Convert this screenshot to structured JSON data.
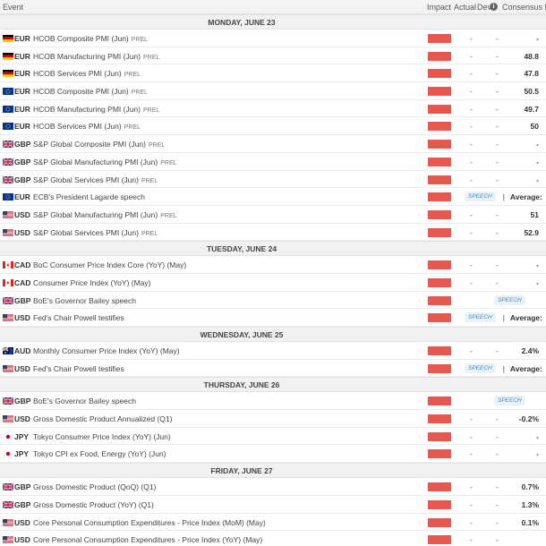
{
  "header": {
    "event": "Event",
    "impact": "Impact",
    "actual": "Actual",
    "dev": "Dev",
    "info": "i",
    "consensus": "Consensus P"
  },
  "days": [
    {
      "label": "MONDAY, JUNE 23",
      "events": [
        {
          "flag": "de",
          "currency": "EUR",
          "name": "HCOB Composite PMI (Jun)",
          "tag": "PREL",
          "actual": "-",
          "dev": "-",
          "consensus": "-"
        },
        {
          "flag": "de",
          "currency": "EUR",
          "name": "HCOB Manufacturing PMI (Jun)",
          "tag": "PREL",
          "actual": "-",
          "dev": "-",
          "consensus": "48.8"
        },
        {
          "flag": "de",
          "currency": "EUR",
          "name": "HCOB Services PMI (Jun)",
          "tag": "PREL",
          "actual": "-",
          "dev": "-",
          "consensus": "47.8"
        },
        {
          "flag": "eu",
          "currency": "EUR",
          "name": "HCOB Composite PMI (Jun)",
          "tag": "PREL",
          "actual": "-",
          "dev": "-",
          "consensus": "50.5"
        },
        {
          "flag": "eu",
          "currency": "EUR",
          "name": "HCOB Manufacturing PMI (Jun)",
          "tag": "PREL",
          "actual": "-",
          "dev": "-",
          "consensus": "49.7"
        },
        {
          "flag": "eu",
          "currency": "EUR",
          "name": "HCOB Services PMI (Jun)",
          "tag": "PREL",
          "actual": "-",
          "dev": "-",
          "consensus": "50"
        },
        {
          "flag": "gb",
          "currency": "GBP",
          "name": "S&P Global Composite PMI (Jun)",
          "tag": "PREL",
          "actual": "-",
          "dev": "-",
          "consensus": "-"
        },
        {
          "flag": "gb",
          "currency": "GBP",
          "name": "S&P Global Manufacturing PMI (Jun)",
          "tag": "PREL",
          "actual": "-",
          "dev": "-",
          "consensus": "-"
        },
        {
          "flag": "gb",
          "currency": "GBP",
          "name": "S&P Global Services PMI (Jun)",
          "tag": "PREL",
          "actual": "-",
          "dev": "-",
          "consensus": "-"
        },
        {
          "flag": "eu",
          "currency": "EUR",
          "name": "ECB's President Lagarde speech",
          "tag": "",
          "speech": "SPEECH",
          "speech_pos": "left",
          "consensus": "Average:"
        },
        {
          "flag": "us",
          "currency": "USD",
          "name": "S&P Global Manufacturing PMI (Jun)",
          "tag": "PREL",
          "actual": "-",
          "dev": "-",
          "consensus": "51"
        },
        {
          "flag": "us",
          "currency": "USD",
          "name": "S&P Global Services PMI (Jun)",
          "tag": "PREL",
          "actual": "-",
          "dev": "-",
          "consensus": "52.9"
        }
      ]
    },
    {
      "label": "TUESDAY, JUNE 24",
      "events": [
        {
          "flag": "ca",
          "currency": "CAD",
          "name": "BoC Consumer Price Index Core (YoY) (May)",
          "tag": "",
          "actual": "-",
          "dev": "-",
          "consensus": "-"
        },
        {
          "flag": "ca",
          "currency": "CAD",
          "name": "Consumer Price Index (YoY) (May)",
          "tag": "",
          "actual": "-",
          "dev": "-",
          "consensus": "-"
        },
        {
          "flag": "gb",
          "currency": "GBP",
          "name": "BoE's Governor Bailey speech",
          "tag": "",
          "speech": "SPEECH",
          "speech_pos": "right",
          "consensus": ""
        },
        {
          "flag": "us",
          "currency": "USD",
          "name": "Fed's Chair Powell testifies",
          "tag": "",
          "speech": "SPEECH",
          "speech_pos": "left",
          "consensus": "Average:"
        }
      ]
    },
    {
      "label": "WEDNESDAY, JUNE 25",
      "events": [
        {
          "flag": "au",
          "currency": "AUD",
          "name": "Monthly Consumer Price Index (YoY) (May)",
          "tag": "",
          "actual": "-",
          "dev": "-",
          "consensus": "2.4%"
        },
        {
          "flag": "us",
          "currency": "USD",
          "name": "Fed's Chair Powell testifies",
          "tag": "",
          "speech": "SPEECH",
          "speech_pos": "left",
          "consensus": "Average:"
        }
      ]
    },
    {
      "label": "THURSDAY, JUNE 26",
      "events": [
        {
          "flag": "gb",
          "currency": "GBP",
          "name": "BoE's Governor Bailey speech",
          "tag": "",
          "speech": "SPEECH",
          "speech_pos": "right",
          "consensus": ""
        },
        {
          "flag": "us",
          "currency": "USD",
          "name": "Gross Domestic Product Annualized (Q1)",
          "tag": "",
          "actual": "-",
          "dev": "-",
          "consensus": "-0.2%"
        },
        {
          "flag": "jp",
          "currency": "JPY",
          "name": "Tokyo Consumer Price Index (YoY) (Jun)",
          "tag": "",
          "actual": "-",
          "dev": "-",
          "consensus": "-"
        },
        {
          "flag": "jp",
          "currency": "JPY",
          "name": "Tokyo CPI ex Food, Energy (YoY) (Jun)",
          "tag": "",
          "actual": "-",
          "dev": "-",
          "consensus": "-"
        }
      ]
    },
    {
      "label": "FRIDAY, JUNE 27",
      "events": [
        {
          "flag": "gb",
          "currency": "GBP",
          "name": "Gross Domestic Product (QoQ) (Q1)",
          "tag": "",
          "actual": "-",
          "dev": "-",
          "consensus": "0.7%"
        },
        {
          "flag": "gb",
          "currency": "GBP",
          "name": "Gross Domestic Product (YoY) (Q1)",
          "tag": "",
          "actual": "-",
          "dev": "-",
          "consensus": "1.3%"
        },
        {
          "flag": "us",
          "currency": "USD",
          "name": "Core Personal Consumption Expenditures - Price Index (MoM) (May)",
          "tag": "",
          "actual": "-",
          "dev": "-",
          "consensus": "0.1%"
        },
        {
          "flag": "us",
          "currency": "USD",
          "name": "Core Personal Consumption Expenditures - Price Index (YoY) (May)",
          "tag": "",
          "actual": "-",
          "dev": "-",
          "consensus": ""
        }
      ]
    }
  ],
  "colors": {
    "impact_high": "#e5574f",
    "speech_bg": "#e8f2fb",
    "speech_text": "#4a86c5"
  }
}
